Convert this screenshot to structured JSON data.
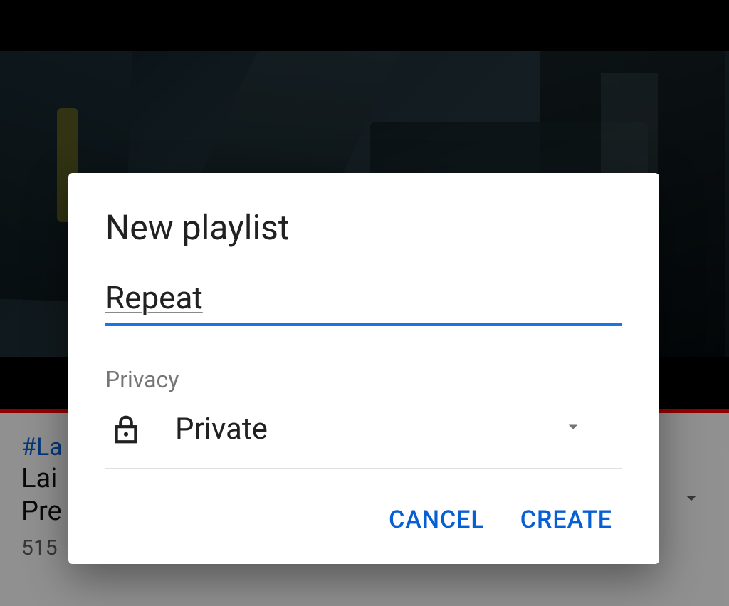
{
  "background": {
    "hashtag": "#La",
    "title_line_1": "Lai",
    "title_line_2": "Pre",
    "stats": "515"
  },
  "dialog": {
    "title": "New playlist",
    "titleInput": {
      "value": "Repeat"
    },
    "privacy": {
      "label": "Privacy",
      "value": "Private"
    },
    "actions": {
      "cancel": "CANCEL",
      "create": "CREATE"
    }
  }
}
